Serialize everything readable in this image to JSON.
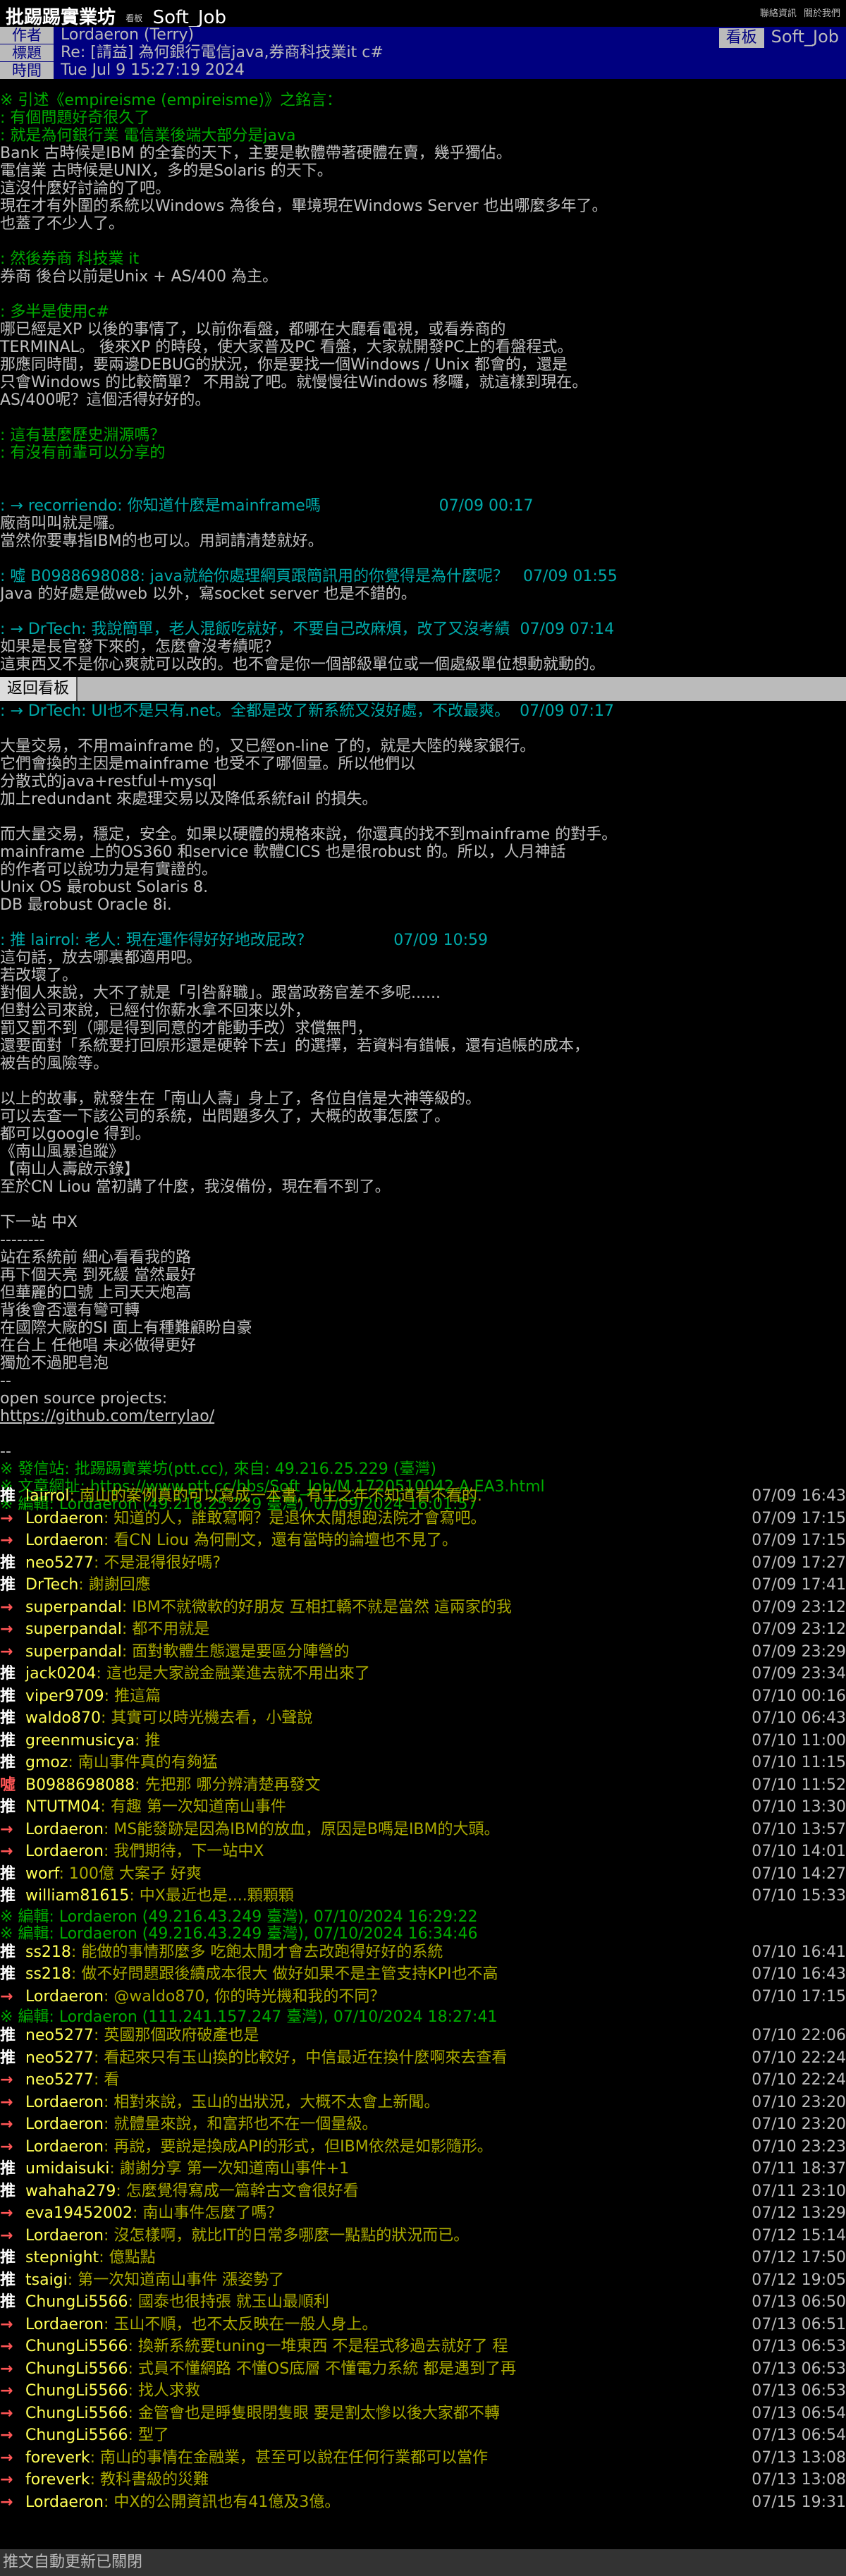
{
  "topbar": {
    "site": "批踢踢實業坊",
    "separator": "›",
    "board_label": "看板",
    "board": "Soft_Job",
    "links": [
      "聯絡資訊",
      "關於我們"
    ]
  },
  "header": {
    "author_label": "作者",
    "author": "Lordaeron (Terry)",
    "board_label": "看板",
    "board": "Soft_Job",
    "title_label": "標題",
    "title": "Re: [請益] 為何銀行電信java,券商科技業it c#",
    "time_label": "時間",
    "time": "Tue Jul  9 15:27:19 2024"
  },
  "body_lines": [
    {
      "t": "※ 引述《empireisme (empireisme)》之銘言：",
      "c": "quote"
    },
    {
      "t": ": 有個問題好奇很久了",
      "c": "quote"
    },
    {
      "t": ": 就是為何銀行業 電信業後端大部分是java",
      "c": "quote"
    },
    {
      "t": "Bank 古時候是IBM 的全套的天下，主要是軟體帶著硬體在賣，幾乎獨佔。",
      "c": "white"
    },
    {
      "t": "電信業 古時候是UNIX，多的是Solaris 的天下。",
      "c": "white"
    },
    {
      "t": "這沒什麼好討論的了吧。",
      "c": "white"
    },
    {
      "t": "現在才有外圍的系統以Windows 為後台，畢境現在Windows Server 也出哪麼多年了。",
      "c": "white"
    },
    {
      "t": "也蓋了不少人了。",
      "c": "white"
    },
    {
      "t": "",
      "c": "white"
    },
    {
      "t": ": 然後券商 科技業 it",
      "c": "quote"
    },
    {
      "t": "券商 後台以前是Unix + AS/400 為主。",
      "c": "white"
    },
    {
      "t": "",
      "c": "white"
    },
    {
      "t": ": 多半是使用c#",
      "c": "quote"
    },
    {
      "t": "哪已經是XP 以後的事情了，以前你看盤，都哪在大廳看電視，或看券商的",
      "c": "white"
    },
    {
      "t": "TERMINAL。 後來XP 的時段，使大家普及PC 看盤，大家就開發PC上的看盤程式。",
      "c": "white"
    },
    {
      "t": "那應同時間，要兩邊DEBUG的狀況，你是要找一個Windows / Unix 都會的，還是",
      "c": "white"
    },
    {
      "t": "只會Windows 的比較簡單？ 不用說了吧。就慢慢往Windows 移囉，就這樣到現在。",
      "c": "white"
    },
    {
      "t": "AS/400呢？這個活得好好的。",
      "c": "white"
    },
    {
      "t": "",
      "c": "white"
    },
    {
      "t": ": 這有甚麼歷史淵源嗎？",
      "c": "quote"
    },
    {
      "t": ": 有沒有前輩可以分享的",
      "c": "quote"
    },
    {
      "t": "",
      "c": "white"
    },
    {
      "t": "",
      "c": "white"
    },
    {
      "t": ": → recorriendo: 你知道什麼是mainframe嗎                        07/09 00:17",
      "c": "quote1"
    },
    {
      "t": "廠商叫叫就是囉。",
      "c": "white"
    },
    {
      "t": "當然你要專指IBM的也可以。用詞請清楚就好。",
      "c": "white"
    },
    {
      "t": "",
      "c": "white"
    },
    {
      "t": ": 噓 B0988698088: java就給你處理網頁跟簡訊用的你覺得是為什麼呢？   07/09 01:55",
      "c": "quote1"
    },
    {
      "t": "Java 的好處是做web 以外，寫socket server 也是不錯的。",
      "c": "white"
    },
    {
      "t": "",
      "c": "white"
    },
    {
      "t": ": → DrTech: 我說簡單，老人混飯吃就好，不要自己改麻煩，改了又沒考績  07/09 07:14",
      "c": "quote1"
    },
    {
      "t": "如果是長官發下來的，怎麼會沒考績呢？",
      "c": "white"
    },
    {
      "t": "這東西又不是你心爽就可以改的。也不會是你一個部級單位或一個處級單位想動就動的。",
      "c": "white"
    }
  ],
  "back_button": "返回看板",
  "body_lines2": [
    {
      "t": ": → DrTech: UI也不是只有.net。全都是改了新系統又沒好處，不改最爽。  07/09 07:17",
      "c": "quote1"
    },
    {
      "t": "",
      "c": "white"
    },
    {
      "t": "大量交易，不用mainframe 的，又已經on-line 了的，就是大陸的幾家銀行。",
      "c": "white"
    },
    {
      "t": "它們會換的主因是mainframe 也受不了哪個量。所以他們以",
      "c": "white"
    },
    {
      "t": "分散式的java+restful+mysql",
      "c": "white"
    },
    {
      "t": "加上redundant 來處理交易以及降低系統fail 的損失。",
      "c": "white"
    },
    {
      "t": "",
      "c": "white"
    },
    {
      "t": "而大量交易，穩定，安全。如果以硬體的規格來說，你還真的找不到mainframe 的對手。",
      "c": "white"
    },
    {
      "t": "mainframe 上的OS360 和service 軟體CICS 也是很robust 的。所以，人月神話",
      "c": "white"
    },
    {
      "t": "的作者可以說功力是有實證的。",
      "c": "white"
    },
    {
      "t": "Unix OS 最robust Solaris 8.",
      "c": "white"
    },
    {
      "t": "DB 最robust Oracle 8i.",
      "c": "white"
    },
    {
      "t": "",
      "c": "white"
    },
    {
      "t": ": 推 lairrol: 老人: 現在運作得好好地改屁改?                  07/09 10:59",
      "c": "quote1"
    },
    {
      "t": "這句話，放去哪裏都適用吧。",
      "c": "white"
    },
    {
      "t": "若改壞了。",
      "c": "white"
    },
    {
      "t": "對個人來說，大不了就是「引咎辭職」。跟當政務官差不多呢......",
      "c": "white"
    },
    {
      "t": "但對公司來說，已經付你薪水拿不回來以外，",
      "c": "white"
    },
    {
      "t": "罰又罰不到（哪是得到同意的才能動手改）求償無門，",
      "c": "white"
    },
    {
      "t": "還要面對「系統要打回原形還是硬幹下去」的選擇，若資料有錯帳，還有追帳的成本，",
      "c": "white"
    },
    {
      "t": "被告的風險等。",
      "c": "white"
    },
    {
      "t": "",
      "c": "white"
    },
    {
      "t": "以上的故事，就發生在「南山人壽」身上了，各位自信是大神等級的。",
      "c": "white"
    },
    {
      "t": "可以去查一下該公司的系統，出問題多久了，大概的故事怎麼了。",
      "c": "white"
    },
    {
      "t": "都可以google 得到。",
      "c": "white"
    },
    {
      "t": "《南山風暴追蹤》",
      "c": "white"
    },
    {
      "t": "【南山人壽啟示錄】",
      "c": "white"
    },
    {
      "t": "至於CN Liou 當初講了什麼，我沒備份，現在看不到了。",
      "c": "white"
    },
    {
      "t": "",
      "c": "white"
    },
    {
      "t": "下一站 中X",
      "c": "white"
    },
    {
      "t": "--------",
      "c": "white"
    },
    {
      "t": "站在系統前 細心看看我的路",
      "c": "white"
    },
    {
      "t": "再下個天亮 到死緩 當然最好",
      "c": "white"
    },
    {
      "t": "但華麗的口號 上司天天炮高",
      "c": "white"
    },
    {
      "t": "背後會否還有彎可轉",
      "c": "white"
    },
    {
      "t": "在國際大廠的SI 面上有種難顧盼自豪",
      "c": "white"
    },
    {
      "t": "在台上 任他唱 未必做得更好",
      "c": "white"
    },
    {
      "t": "獨尬不過肥皂泡",
      "c": "white"
    },
    {
      "t": "--",
      "c": "white"
    },
    {
      "t": "open source projects:",
      "c": "white"
    },
    {
      "t": "https://github.com/terrylao/",
      "c": "link"
    },
    {
      "t": "",
      "c": "white"
    },
    {
      "t": "--",
      "c": "white"
    },
    {
      "t": "※ 發信站: 批踢踢實業坊(ptt.cc), 來自: 49.216.25.229 (臺灣)",
      "c": "green"
    },
    {
      "t": "※ 文章網址: https://www.ptt.cc/bbs/Soft_Job/M.1720510042.A.EA3.html",
      "c": "green"
    },
    {
      "t": "※ 編輯: Lordaeron (49.216.25.229 臺灣), 07/09/2024 16:01:57",
      "c": "green"
    }
  ],
  "pushes": [
    {
      "tag": "推",
      "k": "up",
      "user": "lairrol",
      "msg": ": 南山的案例真的可以寫成一本書, 有生之年不知道看不看的.",
      "ip": "07/09 16:43"
    },
    {
      "tag": "→",
      "k": "arrow",
      "user": "Lordaeron",
      "msg": ": 知道的人，誰敢寫啊？是退休太閒想跑法院才會寫吧。",
      "ip": "07/09 17:15"
    },
    {
      "tag": "→",
      "k": "arrow",
      "user": "Lordaeron",
      "msg": ": 看CN Liou 為何刪文，還有當時的論壇也不見了。",
      "ip": "07/09 17:15"
    },
    {
      "tag": "推",
      "k": "up",
      "user": "neo5277",
      "msg": ": 不是混得很好嗎?",
      "ip": "07/09 17:27"
    },
    {
      "tag": "推",
      "k": "up",
      "user": "DrTech",
      "msg": ": 謝謝回應",
      "ip": "07/09 17:41"
    },
    {
      "tag": "→",
      "k": "arrow",
      "user": "superpandal",
      "msg": ": IBM不就微軟的好朋友 互相扛轎不就是當然 這兩家的我",
      "ip": "07/09 23:12"
    },
    {
      "tag": "→",
      "k": "arrow",
      "user": "superpandal",
      "msg": ": 都不用就是",
      "ip": "07/09 23:12"
    },
    {
      "tag": "→",
      "k": "arrow",
      "user": "superpandal",
      "msg": ": 面對軟體生態還是要區分陣營的",
      "ip": "07/09 23:29"
    },
    {
      "tag": "推",
      "k": "up",
      "user": "jack0204",
      "msg": ": 這也是大家說金融業進去就不用出來了",
      "ip": "07/09 23:34"
    },
    {
      "tag": "推",
      "k": "up",
      "user": "viper9709",
      "msg": ": 推這篇",
      "ip": "07/10 00:16"
    },
    {
      "tag": "推",
      "k": "up",
      "user": "waldo870",
      "msg": ": 其實可以時光機去看，小聲說",
      "ip": "07/10 06:43"
    },
    {
      "tag": "推",
      "k": "up",
      "user": "greenmusicya",
      "msg": ": 推",
      "ip": "07/10 11:00"
    },
    {
      "tag": "推",
      "k": "up",
      "user": "gmoz",
      "msg": ": 南山事件真的有夠猛",
      "ip": "07/10 11:15"
    },
    {
      "tag": "噓",
      "k": "boo",
      "user": "B0988698088",
      "msg": ": 先把那 哪分辨清楚再發文",
      "ip": "07/10 11:52"
    },
    {
      "tag": "推",
      "k": "up",
      "user": "NTUTM04",
      "msg": ": 有趣 第一次知道南山事件",
      "ip": "07/10 13:30"
    },
    {
      "tag": "→",
      "k": "arrow",
      "user": "Lordaeron",
      "msg": ": MS能發跡是因為IBM的放血，原因是B嗎是IBM的大頭。",
      "ip": "07/10 13:57"
    },
    {
      "tag": "→",
      "k": "arrow",
      "user": "Lordaeron",
      "msg": ": 我們期待，下一站中X",
      "ip": "07/10 14:01"
    },
    {
      "tag": "推",
      "k": "up",
      "user": "worf",
      "msg": ": 100億 大案子 好爽",
      "ip": "07/10 14:27"
    },
    {
      "tag": "推",
      "k": "up",
      "user": "william81615",
      "msg": ": 中X最近也是....顆顆顆",
      "ip": "07/10 15:33"
    },
    {
      "tag": "※",
      "k": "edit",
      "user": "",
      "msg": " 編輯: Lordaeron (49.216.43.249 臺灣), 07/10/2024 16:29:22",
      "ip": ""
    },
    {
      "tag": "※",
      "k": "edit",
      "user": "",
      "msg": " 編輯: Lordaeron (49.216.43.249 臺灣), 07/10/2024 16:34:46",
      "ip": ""
    },
    {
      "tag": "推",
      "k": "up",
      "user": "ss218",
      "msg": ": 能做的事情那麼多 吃飽太閒才會去改跑得好好的系統",
      "ip": "07/10 16:41"
    },
    {
      "tag": "推",
      "k": "up",
      "user": "ss218",
      "msg": ": 做不好問題跟後續成本很大 做好如果不是主管支持KPI也不高",
      "ip": "07/10 16:43"
    },
    {
      "tag": "→",
      "k": "arrow",
      "user": "Lordaeron",
      "msg": ": @waldo870, 你的時光機和我的不同？",
      "ip": "07/10 17:15"
    },
    {
      "tag": "※",
      "k": "edit",
      "user": "",
      "msg": " 編輯: Lordaeron (111.241.157.247 臺灣), 07/10/2024 18:27:41",
      "ip": ""
    },
    {
      "tag": "推",
      "k": "up",
      "user": "neo5277",
      "msg": ": 英國那個政府破產也是",
      "ip": "07/10 22:06"
    },
    {
      "tag": "推",
      "k": "up",
      "user": "neo5277",
      "msg": ": 看起來只有玉山換的比較好，中信最近在換什麼啊來去查看",
      "ip": "07/10 22:24"
    },
    {
      "tag": "→",
      "k": "arrow",
      "user": "neo5277",
      "msg": ": 看",
      "ip": "07/10 22:24"
    },
    {
      "tag": "→",
      "k": "arrow",
      "user": "Lordaeron",
      "msg": ": 相對來說，玉山的出狀況，大概不太會上新聞。",
      "ip": "07/10 23:20"
    },
    {
      "tag": "→",
      "k": "arrow",
      "user": "Lordaeron",
      "msg": ": 就體量來說，和富邦也不在一個量級。",
      "ip": "07/10 23:20"
    },
    {
      "tag": "→",
      "k": "arrow",
      "user": "Lordaeron",
      "msg": ": 再說，要說是換成API的形式，但IBM依然是如影隨形。",
      "ip": "07/10 23:23"
    },
    {
      "tag": "推",
      "k": "up",
      "user": "umidaisuki",
      "msg": ": 謝謝分享 第一次知道南山事件+1",
      "ip": "07/11 18:37"
    },
    {
      "tag": "推",
      "k": "up",
      "user": "wahaha279",
      "msg": ": 怎麼覺得寫成一篇幹古文會很好看",
      "ip": "07/11 23:10"
    },
    {
      "tag": "→",
      "k": "arrow",
      "user": "eva19452002",
      "msg": ": 南山事件怎麼了嗎？",
      "ip": "07/12 13:29"
    },
    {
      "tag": "→",
      "k": "arrow",
      "user": "Lordaeron",
      "msg": ": 沒怎樣啊，就比IT的日常多哪麼一點點的狀況而已。",
      "ip": "07/12 15:14"
    },
    {
      "tag": "推",
      "k": "up",
      "user": "stepnight",
      "msg": ": 億點點",
      "ip": "07/12 17:50"
    },
    {
      "tag": "推",
      "k": "up",
      "user": "tsaigi",
      "msg": ": 第一次知道南山事件 漲姿勢了",
      "ip": "07/12 19:05"
    },
    {
      "tag": "推",
      "k": "up",
      "user": "ChungLi5566",
      "msg": ": 國泰也很持張 就玉山最順利",
      "ip": "07/13 06:50"
    },
    {
      "tag": "→",
      "k": "arrow",
      "user": "Lordaeron",
      "msg": ": 玉山不順，也不太反映在一般人身上。",
      "ip": "07/13 06:51"
    },
    {
      "tag": "→",
      "k": "arrow",
      "user": "ChungLi5566",
      "msg": ": 換新系統要tuning一堆東西 不是程式移過去就好了 程",
      "ip": "07/13 06:53"
    },
    {
      "tag": "→",
      "k": "arrow",
      "user": "ChungLi5566",
      "msg": ": 式員不懂網路 不懂OS底層 不懂電力系統 都是遇到了再",
      "ip": "07/13 06:53"
    },
    {
      "tag": "→",
      "k": "arrow",
      "user": "ChungLi5566",
      "msg": ": 找人求救",
      "ip": "07/13 06:53"
    },
    {
      "tag": "→",
      "k": "arrow",
      "user": "ChungLi5566",
      "msg": ": 金管會也是睜隻眼閉隻眼 要是割太慘以後大家都不轉",
      "ip": "07/13 06:54"
    },
    {
      "tag": "→",
      "k": "arrow",
      "user": "ChungLi5566",
      "msg": ": 型了",
      "ip": "07/13 06:54"
    },
    {
      "tag": "→",
      "k": "arrow",
      "user": "foreverk",
      "msg": ": 南山的事情在金融業，甚至可以說在任何行業都可以當作",
      "ip": "07/13 13:08"
    },
    {
      "tag": "→",
      "k": "arrow",
      "user": "foreverk",
      "msg": ": 教科書級的災難",
      "ip": "07/13 13:08"
    },
    {
      "tag": "→",
      "k": "arrow",
      "user": "Lordaeron",
      "msg": ": 中X的公開資訊也有41億及3億。",
      "ip": "07/15 19:31"
    }
  ],
  "footer": "推文自動更新已關閉"
}
